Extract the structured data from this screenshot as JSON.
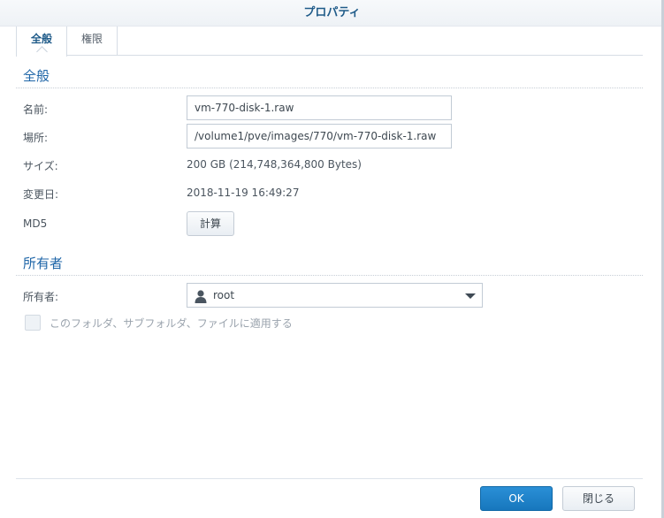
{
  "dialog": {
    "title": "プロパティ"
  },
  "tabs": [
    {
      "label": "全般",
      "active": true
    },
    {
      "label": "権限",
      "active": false
    }
  ],
  "general": {
    "section_title": "全般",
    "name_label": "名前:",
    "name_value": "vm-770-disk-1.raw",
    "location_label": "場所:",
    "location_value": "/volume1/pve/images/770/vm-770-disk-1.raw",
    "size_label": "サイズ:",
    "size_value": "200 GB (214,748,364,800 Bytes)",
    "modified_label": "変更日:",
    "modified_value": "2018-11-19 16:49:27",
    "md5_label": "MD5",
    "calc_button": "計算"
  },
  "owner": {
    "section_title": "所有者",
    "owner_label": "所有者:",
    "owner_value": "root",
    "owner_icon": "user-icon",
    "apply_label": "このフォルダ、サブフォルダ、ファイルに適用する",
    "apply_checked": false
  },
  "footer": {
    "ok_label": "OK",
    "close_label": "閉じる"
  },
  "colors": {
    "accent": "#1f66a8",
    "primary_button": "#1777bd"
  }
}
